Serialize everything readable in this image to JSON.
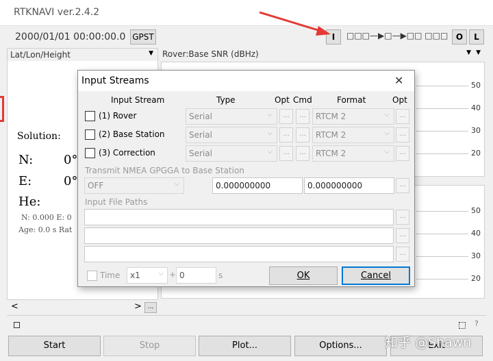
{
  "window": {
    "title": "RTKNAVI ver.2.4.2"
  },
  "toolbar": {
    "datetime": "2000/01/01 00:00:00.0",
    "time_sys_button": "GPST",
    "input_button": "I",
    "stream_status": "□□□—▶□—▶□□ □□□",
    "output_button": "O",
    "log_button": "L"
  },
  "left_panel": {
    "mode_select": "Lat/Lon/Height",
    "solution_label": "Solution:",
    "n_label": "N:",
    "n_value": "0°",
    "e_label": "E:",
    "e_value": "0°",
    "he_label": "He:",
    "stats_line": "N: 0.000 E: 0",
    "age_line": "Age: 0.0 s Rat"
  },
  "right_panel": {
    "plot_select": "Rover:Base SNR (dBHz)",
    "top_ticks": [
      "50",
      "40",
      "30",
      "20"
    ],
    "bottom_ticks": [
      "50",
      "40",
      "30",
      "20"
    ]
  },
  "nav": {
    "prev": "<",
    "next": ">",
    "more": "..."
  },
  "bottom_buttons": {
    "start": "Start",
    "stop": "Stop",
    "plot": "Plot...",
    "options": "Options...",
    "exit": "Exit"
  },
  "watermark": "知乎 @Shawn",
  "dialog": {
    "title": "Input Streams",
    "close_glyph": "✕",
    "headers": {
      "input_stream": "Input Stream",
      "type": "Type",
      "opt": "Opt",
      "cmd": "Cmd",
      "format": "Format",
      "opt2": "Opt"
    },
    "rows": [
      {
        "label": "(1) Rover",
        "type": "Serial",
        "format": "RTCM 2"
      },
      {
        "label": "(2) Base Station",
        "type": "Serial",
        "format": "RTCM 2"
      },
      {
        "label": "(3) Correction",
        "type": "Serial",
        "format": "RTCM 2"
      }
    ],
    "dots": "...",
    "nmea_label": "Transmit NMEA GPGGA to Base Station",
    "nmea_mode": "OFF",
    "nmea_lat": "0.000000000",
    "nmea_lon": "0.000000000",
    "file_paths_label": "Input File Paths",
    "time_label": "Time",
    "speed": "x1",
    "plus": "+",
    "offset": "0",
    "seconds": "s",
    "ok": "OK",
    "cancel": "Cancel"
  }
}
